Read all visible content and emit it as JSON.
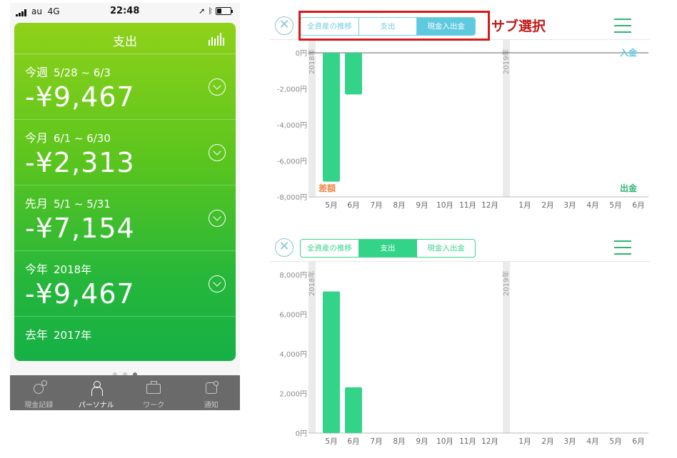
{
  "phone": {
    "status": {
      "carrier": "au",
      "network": "4G",
      "time": "22:48"
    },
    "header": {
      "title": "支出"
    },
    "rows": [
      {
        "label": "今週",
        "range": "5/28 ~ 6/3",
        "amount": "-¥9,467"
      },
      {
        "label": "今月",
        "range": "6/1 ~ 6/30",
        "amount": "-¥2,313"
      },
      {
        "label": "先月",
        "range": "5/1 ~ 5/31",
        "amount": "-¥7,154"
      },
      {
        "label": "今年",
        "range": "2018年",
        "amount": "-¥9,467"
      },
      {
        "label": "去年",
        "range": "2017年"
      }
    ],
    "tabs": [
      {
        "label": "現金記録",
        "icon": "record-icon"
      },
      {
        "label": "パーソナル",
        "icon": "person-icon"
      },
      {
        "label": "ワーク",
        "icon": "bag-icon"
      },
      {
        "label": "通知",
        "icon": "notification-icon"
      }
    ]
  },
  "annotation": {
    "label": "サブ選択",
    "color": "#d7191c"
  },
  "panels": [
    {
      "segments": [
        "全資産の推移",
        "支出",
        "現金入出金"
      ],
      "selected": 2,
      "accent": "#5ec9df"
    },
    {
      "segments": [
        "全資産の推移",
        "支出",
        "現金入出金"
      ],
      "selected": 1,
      "accent": "#33d48a"
    }
  ],
  "chart_data": [
    {
      "type": "bar",
      "categories": [
        "5月",
        "6月",
        "7月",
        "8月",
        "9月",
        "10月",
        "11月",
        "12月",
        "1月",
        "2月",
        "3月",
        "4月",
        "5月",
        "6月"
      ],
      "year_labels": [
        "2018年",
        "2019年"
      ],
      "values": [
        -7154,
        -2313,
        0,
        0,
        0,
        0,
        0,
        0,
        0,
        0,
        0,
        0,
        0,
        0
      ],
      "yticks": [
        "0円",
        "-2,000円",
        "-4,000円",
        "-6,000円",
        "-8,000円"
      ],
      "ylim": [
        -8000,
        0
      ],
      "legend": {
        "in": "入金",
        "out": "出金",
        "diff": "差額"
      },
      "colors": {
        "bar": "#33d48a",
        "in": "#5ec9df",
        "out": "#2bb673",
        "diff": "#f08a4b"
      }
    },
    {
      "type": "bar",
      "categories": [
        "5月",
        "6月",
        "7月",
        "8月",
        "9月",
        "10月",
        "11月",
        "12月",
        "1月",
        "2月",
        "3月",
        "4月",
        "5月",
        "6月"
      ],
      "year_labels": [
        "2018年",
        "2019年"
      ],
      "values": [
        7154,
        2313,
        0,
        0,
        0,
        0,
        0,
        0,
        0,
        0,
        0,
        0,
        0,
        0
      ],
      "yticks": [
        "8,000円",
        "6,000円",
        "4,000円",
        "2,000円",
        "0円"
      ],
      "ylim": [
        0,
        8000
      ],
      "colors": {
        "bar": "#33d48a"
      }
    }
  ]
}
